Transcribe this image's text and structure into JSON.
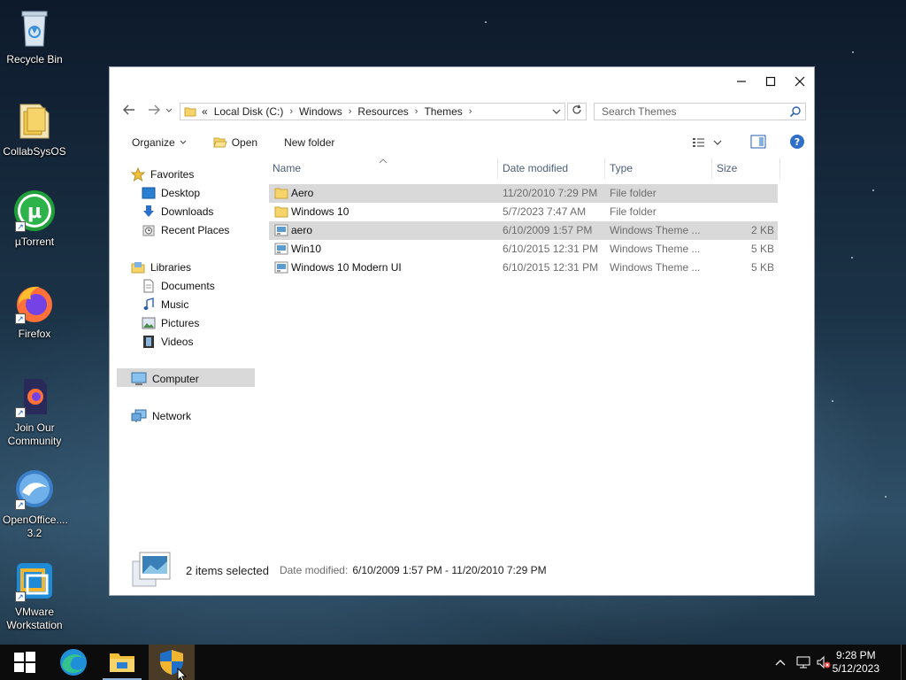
{
  "desktop": {
    "icons": [
      {
        "label": "Recycle Bin"
      },
      {
        "label": "CollabSysOS"
      },
      {
        "label": "µTorrent"
      },
      {
        "label": "Firefox"
      },
      {
        "label": "Join Our Community"
      },
      {
        "label": "OpenOffice.... 3.2"
      },
      {
        "label": "VMware Workstation"
      }
    ]
  },
  "window": {
    "address": {
      "overflow": "«",
      "crumbs": [
        "Local Disk (C:)",
        "Windows",
        "Resources",
        "Themes"
      ]
    },
    "search_placeholder": "Search Themes",
    "commands": {
      "organize": "Organize",
      "open": "Open",
      "new_folder": "New folder"
    },
    "nav": {
      "favorites": "Favorites",
      "desktop": "Desktop",
      "downloads": "Downloads",
      "recent_places": "Recent Places",
      "libraries": "Libraries",
      "documents": "Documents",
      "music": "Music",
      "pictures": "Pictures",
      "videos": "Videos",
      "computer": "Computer",
      "network": "Network"
    },
    "columns": {
      "name": "Name",
      "date_modified": "Date modified",
      "type": "Type",
      "size": "Size"
    },
    "files": [
      {
        "name": "Aero",
        "date": "11/20/2010 7:29 PM",
        "type": "File folder",
        "size": "",
        "kind": "folder",
        "selected": true
      },
      {
        "name": "Windows 10",
        "date": "5/7/2023 7:47 AM",
        "type": "File folder",
        "size": "",
        "kind": "folder",
        "selected": false
      },
      {
        "name": "aero",
        "date": "6/10/2009 1:57 PM",
        "type": "Windows Theme ...",
        "size": "2 KB",
        "kind": "theme",
        "selected": true
      },
      {
        "name": "Win10",
        "date": "6/10/2015 12:31 PM",
        "type": "Windows Theme ...",
        "size": "5 KB",
        "kind": "theme",
        "selected": false
      },
      {
        "name": "Windows 10 Modern UI",
        "date": "6/10/2015 12:31 PM",
        "type": "Windows Theme ...",
        "size": "5 KB",
        "kind": "theme",
        "selected": false
      }
    ],
    "status": {
      "count": "2 items selected",
      "date_label": "Date modified:",
      "date_value": "6/10/2009 1:57 PM - 11/20/2010 7:29 PM"
    }
  },
  "taskbar": {
    "time": "9:28 PM",
    "date": "5/12/2023"
  },
  "colors": {
    "selection": "#d9d9d9",
    "folder": "#f7d46a",
    "header_text": "#4c607a"
  }
}
